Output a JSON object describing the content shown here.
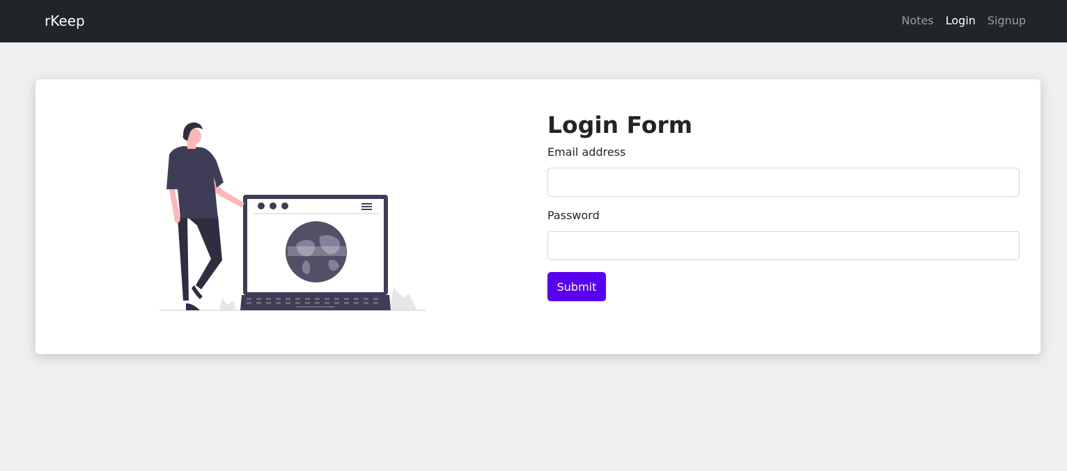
{
  "navbar": {
    "brand": "rKeep",
    "links": [
      {
        "label": "Notes",
        "active": false
      },
      {
        "label": "Login",
        "active": true
      },
      {
        "label": "Signup",
        "active": false
      }
    ]
  },
  "illustration": {
    "icon": "person-with-laptop-illustration"
  },
  "login_form": {
    "title": "Login Form",
    "email_label": "Email address",
    "email_value": "",
    "password_label": "Password",
    "password_value": "",
    "submit_label": "Submit"
  },
  "colors": {
    "navbar_bg": "#212529",
    "page_bg": "#efefef",
    "accent": "#5a00f0",
    "illustration_dark": "#3f3d56",
    "illustration_skin": "#ffb6b6"
  }
}
